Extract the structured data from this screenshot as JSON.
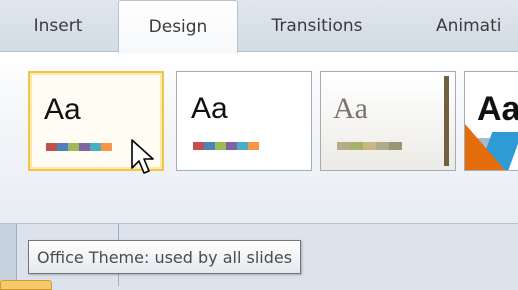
{
  "tabs": [
    {
      "label": "Insert",
      "active": false
    },
    {
      "label": "Design",
      "active": true
    },
    {
      "label": "Transitions",
      "active": false
    },
    {
      "label": "Animati",
      "active": false
    }
  ],
  "themes": [
    {
      "sample": "Aa",
      "swatches": [
        "#c0504d",
        "#4f81bd",
        "#9bbb59",
        "#8064a2",
        "#4bacc6",
        "#f79646"
      ]
    },
    {
      "sample": "Aa",
      "swatches": [
        "#c0504d",
        "#4f81bd",
        "#9bbb59",
        "#8064a2",
        "#4bacc6",
        "#f79646"
      ]
    },
    {
      "sample": "Aa",
      "swatches": [
        "#b7ac8a",
        "#a5b26a",
        "#c7b884",
        "#b0a98b",
        "#9b9673"
      ]
    },
    {
      "sample": "Aa"
    }
  ],
  "tooltip": {
    "text": "Office Theme: used by all slides"
  },
  "colors": {
    "selected_border": "#f0c54a",
    "tooltip_border": "#767676"
  }
}
